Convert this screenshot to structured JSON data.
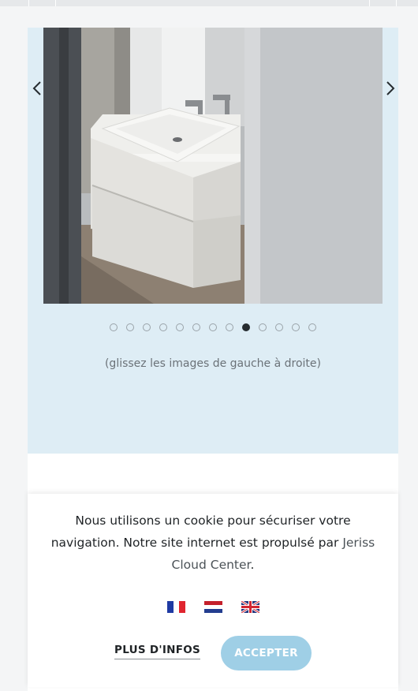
{
  "gallery": {
    "photo_alt": "",
    "total_slides": 13,
    "active_slide": 9,
    "hint": "(glissez les images de gauche à droite)",
    "prev_icon": "chevron-left-icon",
    "next_icon": "chevron-right-icon"
  },
  "cookie": {
    "text_before": "Nous utilisons un cookie pour sécuriser votre navigation. Notre site internet est propulsé par ",
    "link": "Jeriss Cloud Center",
    "text_after": ".",
    "languages": [
      "fr",
      "nl",
      "en"
    ],
    "more_info": "PLUS D'INFOS",
    "accept": "ACCEPTER"
  },
  "colors": {
    "hero_background": "#deedf5",
    "accept_button": "#9fcfe6",
    "active_dot": "#262c30"
  }
}
